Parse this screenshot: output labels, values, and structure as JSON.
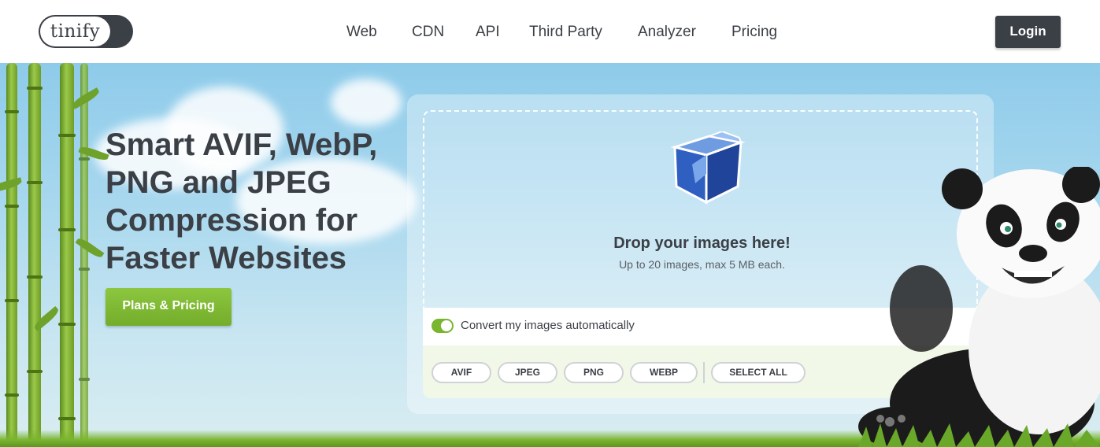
{
  "header": {
    "logo_text": "tinify",
    "nav": [
      "Web",
      "CDN",
      "API",
      "Third Party",
      "Analyzer",
      "Pricing"
    ],
    "login_label": "Login"
  },
  "hero": {
    "headline": "Smart AVIF, WebP, PNG and JPEG Compression for Faster Websites",
    "plans_button": "Plans & Pricing"
  },
  "upload": {
    "drop_title": "Drop your images here!",
    "drop_subtitle": "Up to 20 images, max 5 MB each.",
    "convert_label": "Convert my images automatically",
    "convert_enabled": true,
    "formats": [
      "AVIF",
      "JPEG",
      "PNG",
      "WEBP"
    ],
    "select_all": "SELECT ALL",
    "box_icon": "cardboard-box-icon"
  },
  "colors": {
    "dark": "#3b3f46",
    "green": "#7ab52f",
    "sky": "#a7d7ee"
  }
}
